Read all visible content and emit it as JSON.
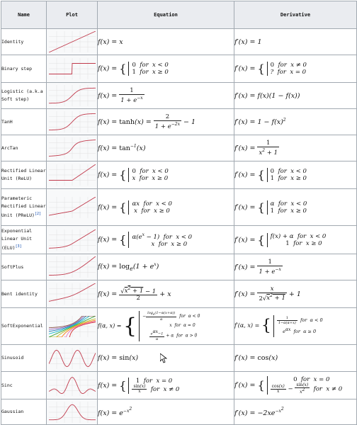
{
  "header": {
    "name": "Name",
    "plot": "Plot",
    "equation": "Equation",
    "derivative": "Derivative"
  },
  "rows": [
    {
      "name": "Identity",
      "eq": "f(x) = x",
      "der": "f′(x) = 1",
      "plot": "identity"
    },
    {
      "name": "Binary step",
      "eq": "f(x) = {0 for x < 0 ; 1 for x ≥ 0}",
      "der": "f′(x) = {0 for x ≠ 0 ; ? for x = 0}",
      "plot": "step"
    },
    {
      "name": "Logistic (a.k.a Soft step)",
      "eq": "f(x) = 1 / (1 + e^−x)",
      "der": "f′(x) = f(x)(1 − f(x))",
      "plot": "logistic"
    },
    {
      "name": "TanH",
      "eq": "f(x) = tanh(x) = 2 / (1 + e^−2x) − 1",
      "der": "f′(x) = 1 − f(x)²",
      "plot": "tanh"
    },
    {
      "name": "ArcTan",
      "eq": "f(x) = tan⁻¹(x)",
      "der": "f′(x) = 1 / (x² + 1)",
      "plot": "arctan"
    },
    {
      "name": "Rectified Linear Unit (ReLU)",
      "eq": "f(x) = {0 for x < 0 ; x for x ≥ 0}",
      "der": "f′(x) = {0 for x < 0 ; 1 for x ≥ 0}",
      "plot": "relu"
    },
    {
      "name": "Parameteric Rectified Linear Unit (PReLU)",
      "ref": "[2]",
      "eq": "f(x) = {αx for x < 0 ; x for x ≥ 0}",
      "der": "f′(x) = {α for x < 0 ; 1 for x ≥ 0}",
      "plot": "prelu"
    },
    {
      "name": "Exponential Linear Unit (ELU)",
      "ref": "[3]",
      "eq": "f(x) = {α(e^x − 1) for x < 0 ; x for x ≥ 0}",
      "der": "f′(x) = {f(x) + α for x < 0 ; 1 for x ≥ 0}",
      "plot": "elu"
    },
    {
      "name": "SoftPlus",
      "eq": "f(x) = logₑ(1 + eˣ)",
      "der": "f′(x) = 1 / (1 + e^−x)",
      "plot": "softplus"
    },
    {
      "name": "Bent identity",
      "eq": "f(x) = (√(x² + 1) − 1) / 2 + x",
      "der": "f′(x) = x / (2√(x² + 1)) + 1",
      "plot": "bent"
    },
    {
      "name": "SoftExponential",
      "eq": "f(α, x) = {−log_e(1 − α(x + α))/α for α < 0 ; x for α = 0 ; (e^αx − 1)/α + α for α > 0}",
      "der": "f′(α, x) = {1/(1 − α(α + x)) for α < 0 ; e^αx for α ≥ 0}",
      "plot": "softexp"
    },
    {
      "name": "Sinusoid",
      "eq": "f(x) = sin(x)",
      "der": "f′(x) = cos(x)",
      "plot": "sin"
    },
    {
      "name": "Sinc",
      "eq": "f(x) = {1 for x = 0 ; sin(x)/x for x ≠ 0}",
      "der": "f′(x) = {0 for x = 0 ; cos(x)/x − sin(x)/x² for x ≠ 0}",
      "plot": "sinc"
    },
    {
      "name": "Gaussian",
      "eq": "f(x) = e^−x²",
      "der": "f′(x) = −2xe^−x²",
      "plot": "gauss"
    }
  ],
  "colors": {
    "curve": "#c0394b",
    "grid": "#dcdcdc",
    "header_bg": "#eaecf0",
    "link": "#0645ad"
  }
}
